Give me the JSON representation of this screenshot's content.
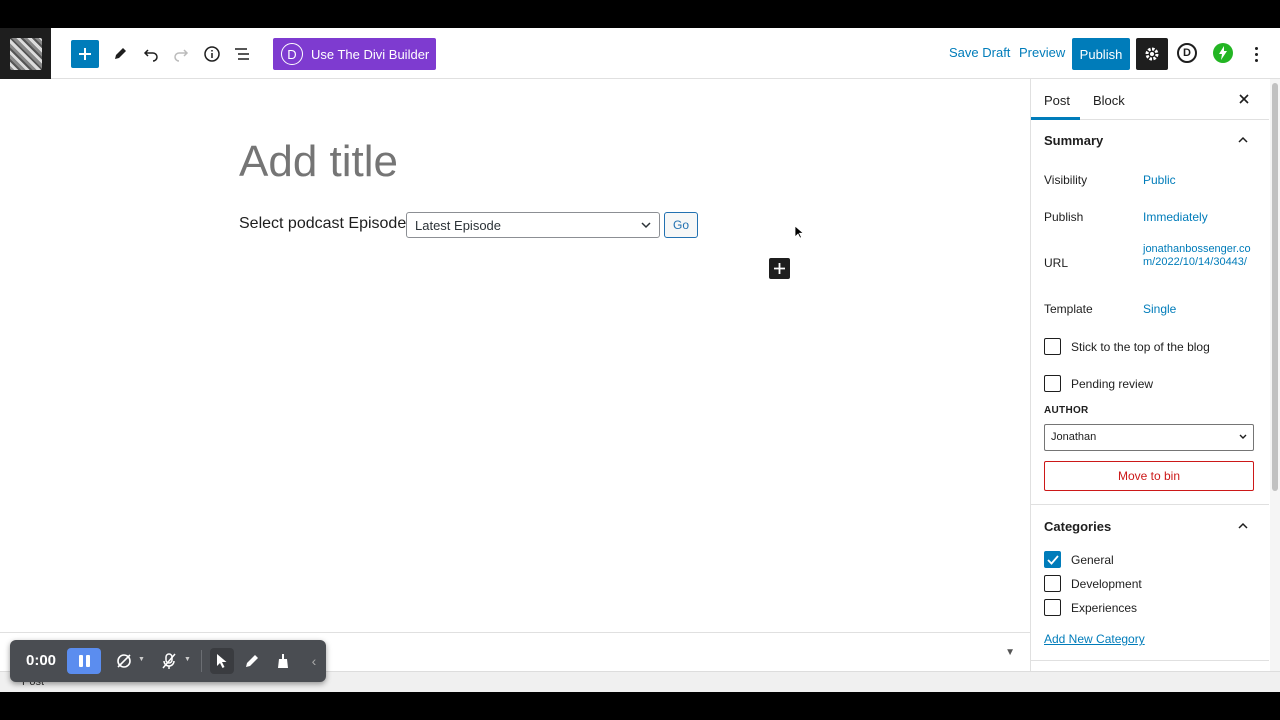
{
  "toolbar": {
    "divi_label": "Use The Divi Builder",
    "divi_logo_letter": "D",
    "save_draft_label": "Save Draft",
    "preview_label": "Preview",
    "publish_label": "Publish",
    "d_icon_letter": "D",
    "accent_color": "#007cba",
    "divi_color": "#7e3bd0"
  },
  "editor": {
    "title_placeholder": "Add title",
    "podcast_label": "Select podcast Episode",
    "episode_selected": "Latest Episode",
    "go_label": "Go"
  },
  "sidebar": {
    "tabs": [
      "Post",
      "Block"
    ],
    "active_tab": "Post",
    "summary": {
      "heading": "Summary",
      "visibility_label": "Visibility",
      "visibility_value": "Public",
      "publish_label": "Publish",
      "publish_value": "Immediately",
      "url_label": "URL",
      "url_value": "jonathanbossenger.com/2022/10/14/30443/",
      "template_label": "Template",
      "template_value": "Single",
      "sticky_label": "Stick to the top of the blog",
      "sticky_checked": false,
      "pending_label": "Pending review",
      "pending_checked": false,
      "author_heading": "AUTHOR",
      "author_value": "Jonathan",
      "bin_label": "Move to bin"
    },
    "categories": {
      "heading": "Categories",
      "items": [
        {
          "label": "General",
          "checked": true
        },
        {
          "label": "Development",
          "checked": false
        },
        {
          "label": "Experiences",
          "checked": false
        }
      ],
      "add_new_label": "Add New Category"
    }
  },
  "status_bar": {
    "breadcrumb": "Post"
  },
  "recorder": {
    "time": "0:00"
  }
}
